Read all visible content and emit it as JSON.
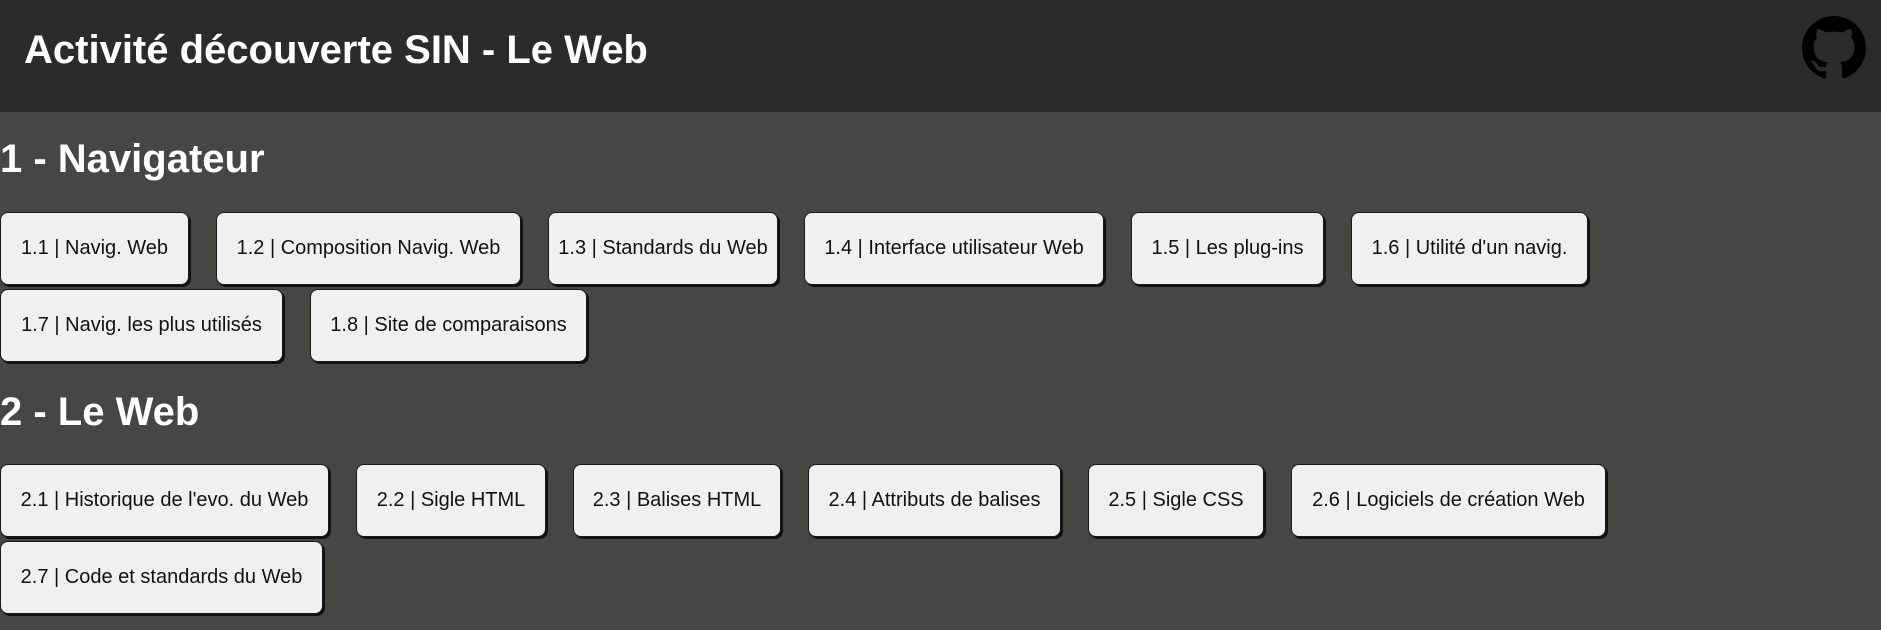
{
  "header": {
    "title": "Activité découverte SIN - Le Web",
    "github_icon": "github-icon"
  },
  "sections": [
    {
      "title": "1 - Navigateur",
      "buttons": [
        "1.1 | Navig. Web",
        "1.2 | Composition Navig. Web",
        "1.3 | Standards du Web",
        "1.4 | Interface utilisateur Web",
        "1.5 | Les plug-ins",
        "1.6 | Utilité d'un navig.",
        "1.7 | Navig. les plus utilisés",
        "1.8 | Site de comparaisons"
      ]
    },
    {
      "title": "2 - Le Web",
      "buttons": [
        "2.1 | Historique de l'evo. du Web",
        "2.2 | Sigle HTML",
        "2.3 | Balises HTML",
        "2.4 | Attributs de balises",
        "2.5 | Sigle CSS",
        "2.6 | Logiciels de création Web",
        "2.7 | Code et standards du Web"
      ]
    }
  ],
  "colors": {
    "header_bg": "#2b2b2b",
    "page_bg": "#464745",
    "button_bg": "#f0f0f0",
    "text_light": "#ffffff"
  }
}
